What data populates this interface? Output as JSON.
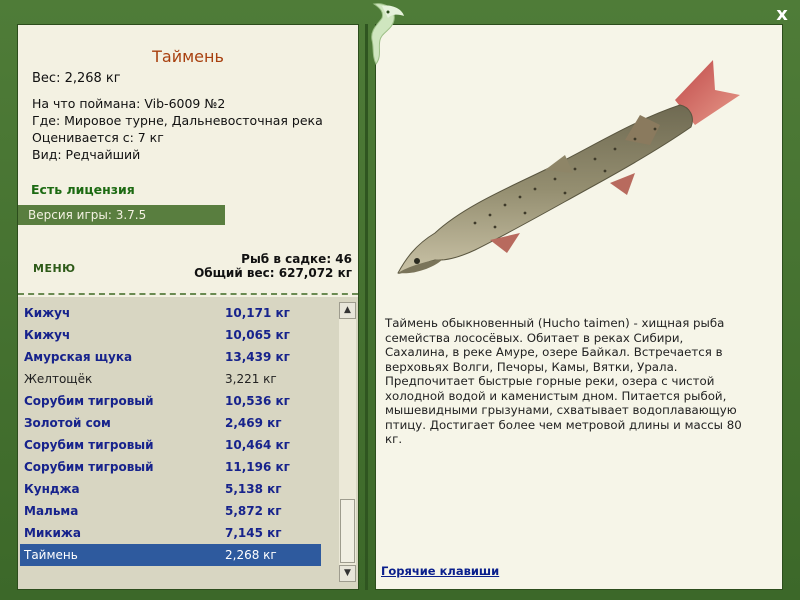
{
  "fish": {
    "title": "Таймень",
    "weight": "Вес: 2,268 кг",
    "bait": "На что поймана: Vib-6009 №2",
    "where": "Где: Мировое турне, Дальневосточная река",
    "valued": "Оценивается с: 7 кг",
    "kind": "Вид: Редчайший"
  },
  "license": "Есть лицензия",
  "version": "Версия игры: 3.7.5",
  "menu_label": "МЕНЮ",
  "stats": {
    "count": "Рыб в садке: 46",
    "total": "Общий вес: 627,072 кг"
  },
  "catch_list": [
    {
      "name": "Кижуч",
      "weight": "10,171 кг"
    },
    {
      "name": "Кижуч",
      "weight": "10,065 кг"
    },
    {
      "name": "Амурская щука",
      "weight": "13,439 кг"
    },
    {
      "name": "Желтощёк",
      "weight": "3,221 кг"
    },
    {
      "name": "Сорубим тигровый",
      "weight": "10,536 кг"
    },
    {
      "name": "Золотой сом",
      "weight": "2,469 кг"
    },
    {
      "name": "Сорубим тигровый",
      "weight": "10,464 кг"
    },
    {
      "name": "Сорубим тигровый",
      "weight": "11,196 кг"
    },
    {
      "name": "Кунджа",
      "weight": "5,138 кг"
    },
    {
      "name": "Мальма",
      "weight": "5,872 кг"
    },
    {
      "name": "Микижа",
      "weight": "7,145 кг"
    },
    {
      "name": "Таймень",
      "weight": "2,268 кг"
    }
  ],
  "description": "Таймень обыкновенный (Hucho taimen) - хищная рыба семейства лососёвых. Обитает в реках Сибири, Сахалина, в реке Амуре, озере Байкал. Встречается в верховьях Волги, Печоры, Камы, Вятки, Урала. Предпочитает быстрые горные реки, озера с чистой холодной водой и каменистым дном. Питается рыбой, мышевидными грызунами, схватывает водоплавающую птицу. Достигает более чем метровой длины и массы 80 кг.",
  "hotkeys": "Горячие клавиши",
  "close_symbol": "x",
  "colors": {
    "frame": "#3f6a2c",
    "title": "#a8400f",
    "license": "#1c6a12",
    "list_text": "#17238c",
    "selected": "#2e5a9e"
  }
}
